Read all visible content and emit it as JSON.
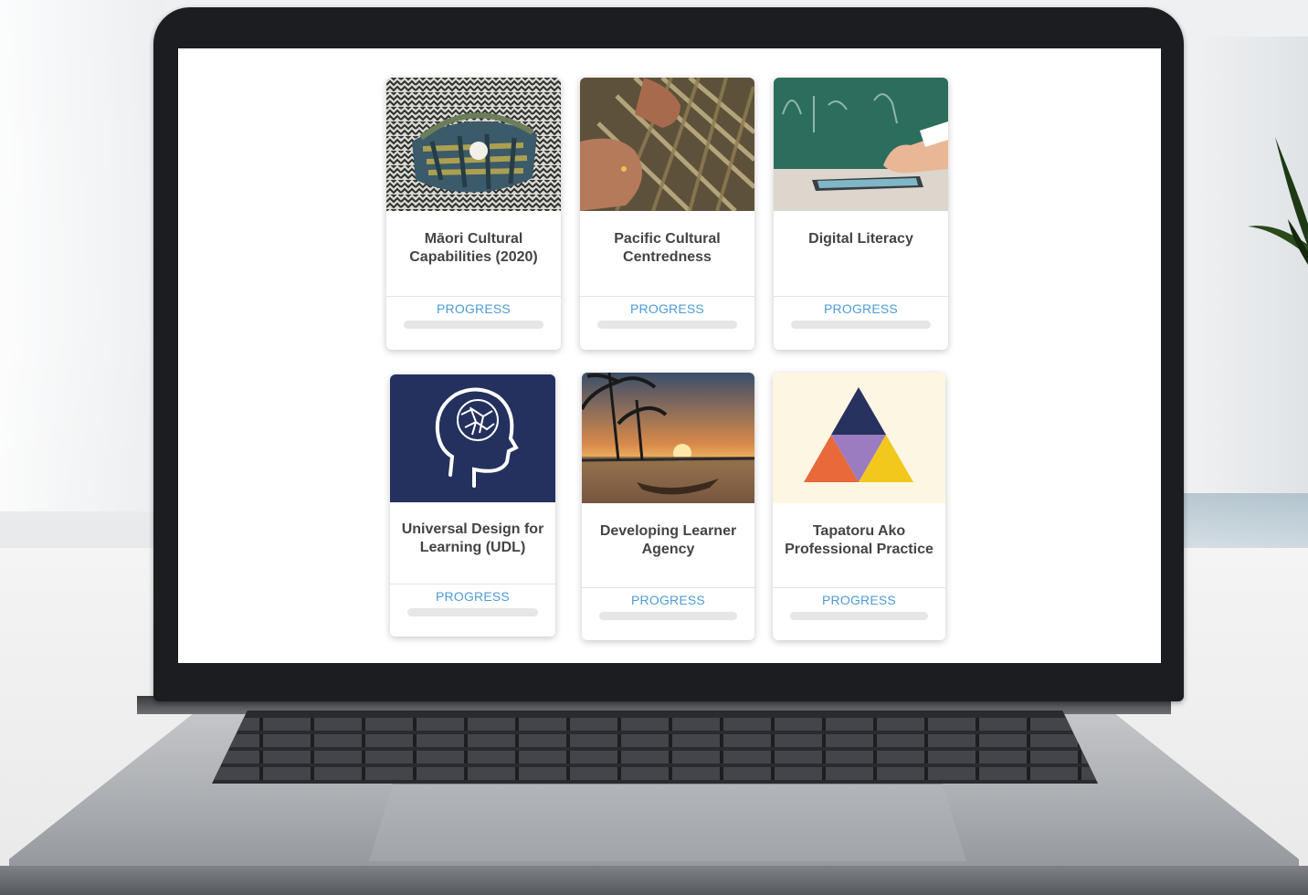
{
  "courses": [
    {
      "title": "Māori Cultural Capabilities (2020)",
      "progress_label": "PROGRESS",
      "progress": 0,
      "thumbnail": "woven-flax-kete-image"
    },
    {
      "title": "Pacific Cultural Centredness",
      "progress_label": "PROGRESS",
      "progress": 0,
      "thumbnail": "hands-weaving-image"
    },
    {
      "title": "Digital Literacy",
      "progress_label": "PROGRESS",
      "progress": 0,
      "thumbnail": "tablet-classroom-image"
    },
    {
      "title": "Universal Design for Learning (UDL)",
      "progress_label": "PROGRESS",
      "progress": 0,
      "thumbnail": "head-brain-icon"
    },
    {
      "title": "Developing Learner Agency",
      "progress_label": "PROGRESS",
      "progress": 0,
      "thumbnail": "sunset-canoe-image"
    },
    {
      "title": "Tapatoru Ako Professional Practice",
      "progress_label": "PROGRESS",
      "progress": 0,
      "thumbnail": "triangle-logo"
    }
  ],
  "colors": {
    "progress_accent": "#4f9bd6",
    "title_text": "#444444",
    "udl_background": "#24315e",
    "tapatoru_background": "#fdf6e2",
    "triangle_top": "#27325f",
    "triangle_left": "#e86a3a",
    "triangle_center": "#9b7cc0",
    "triangle_right": "#f2c81d"
  }
}
